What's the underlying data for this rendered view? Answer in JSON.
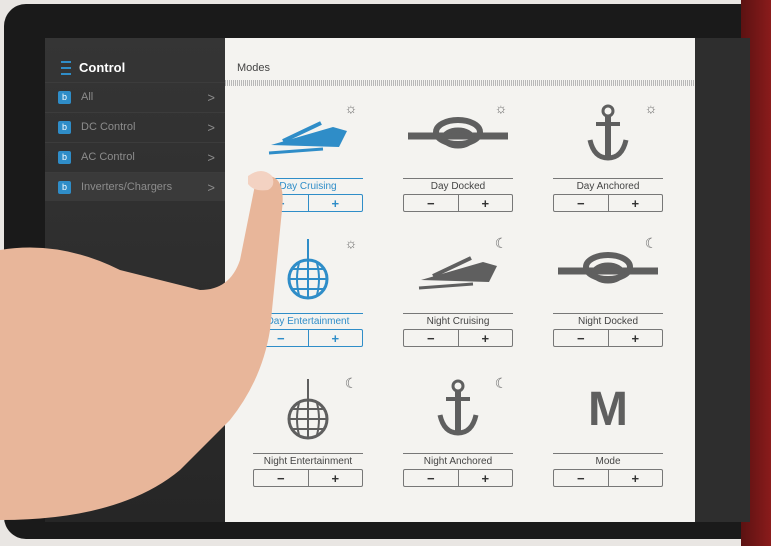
{
  "sidebar": {
    "header": "Control",
    "items": [
      {
        "label": "All",
        "chevron": ">"
      },
      {
        "label": "DC Control",
        "chevron": ">"
      },
      {
        "label": "AC Control",
        "chevron": ">"
      },
      {
        "label": "Inverters/Chargers",
        "chevron": ">"
      }
    ],
    "badge_letter": "b",
    "accent": "#2f8dc8"
  },
  "main": {
    "title": "Modes",
    "modes": [
      {
        "label": "Day Cruising",
        "icon": "boat-icon",
        "time": "sun-icon"
      },
      {
        "label": "Day Docked",
        "icon": "knot-icon",
        "time": "sun-icon"
      },
      {
        "label": "Day Anchored",
        "icon": "anchor-icon",
        "time": "sun-icon"
      },
      {
        "label": "Day Entertainment",
        "icon": "disco-ball-icon",
        "time": "sun-icon"
      },
      {
        "label": "Night Cruising",
        "icon": "boat-icon",
        "time": "moon-icon"
      },
      {
        "label": "Night Docked",
        "icon": "knot-icon",
        "time": "moon-icon"
      },
      {
        "label": "Night Entertainment",
        "icon": "disco-ball-icon",
        "time": "moon-icon"
      },
      {
        "label": "Night Anchored",
        "icon": "anchor-icon",
        "time": "moon-icon"
      },
      {
        "label": "Mode",
        "icon": "letter-m-icon",
        "icon_text": "M"
      }
    ],
    "stepper": {
      "minus": "−",
      "plus": "+"
    }
  },
  "glyphs": {
    "sun": "☼",
    "moon": "☾"
  }
}
